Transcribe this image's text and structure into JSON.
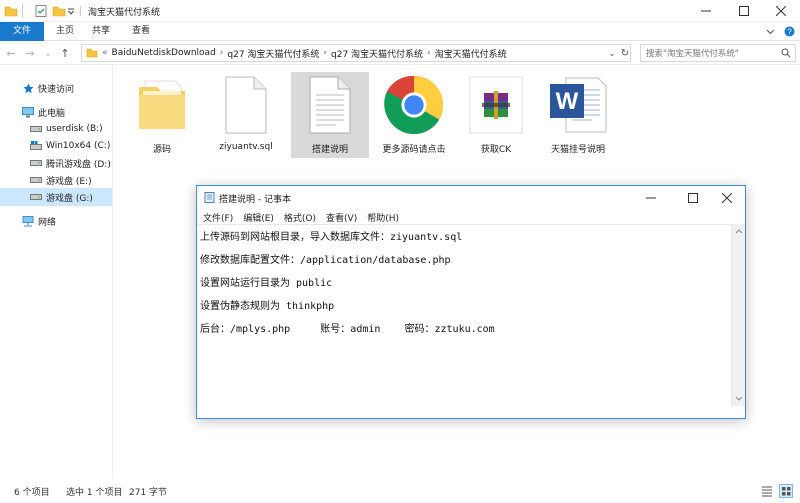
{
  "explorer": {
    "title": "淘宝天猫代付系统",
    "ribbon_tabs": [
      "文件",
      "主页",
      "共享",
      "查看"
    ],
    "breadcrumb": [
      "BaiduNetdiskDownload",
      "q27 淘宝天猫代付系统",
      "q27 淘宝天猫代付系统",
      "淘宝天猫代付系统"
    ],
    "breadcrumb_prefix": "«",
    "search_placeholder": "搜索\"淘宝天猫代付系统\""
  },
  "sidebar": {
    "items": [
      {
        "label": "快速访问",
        "icon": "star-icon"
      },
      {
        "label": "此电脑",
        "icon": "computer-icon"
      },
      {
        "label": "userdisk (B:)",
        "icon": "drive-icon"
      },
      {
        "label": "Win10x64 (C:)",
        "icon": "windows-drive-icon"
      },
      {
        "label": "腾讯游戏盘 (D:)",
        "icon": "drive-icon"
      },
      {
        "label": "游戏盘 (E:)",
        "icon": "drive-icon"
      },
      {
        "label": "游戏盘 (G:)",
        "icon": "drive-icon",
        "selected": true
      },
      {
        "label": "网络",
        "icon": "network-icon"
      }
    ]
  },
  "files": [
    {
      "label": "源码",
      "icon": "folder-icon"
    },
    {
      "label": "ziyuantv.sql",
      "icon": "sql-file-icon"
    },
    {
      "label": "搭建说明",
      "icon": "text-file-icon",
      "selected": true
    },
    {
      "label": "更多源码请点击",
      "icon": "chrome-icon"
    },
    {
      "label": "获取CK",
      "icon": "winrar-icon"
    },
    {
      "label": "天猫挂号说明",
      "icon": "word-icon"
    }
  ],
  "status": {
    "item_count": "6 个项目",
    "selected": "选中 1 个项目",
    "size": "271 字节"
  },
  "notepad": {
    "title": "搭建说明 - 记事本",
    "menu": [
      "文件(F)",
      "编辑(E)",
      "格式(O)",
      "查看(V)",
      "帮助(H)"
    ],
    "lines": [
      "上传源码到网站根目录，导入数据库文件：ziyuantv.sql",
      "修改数据库配置文件：/application/database.php",
      "设置网站运行目录为 public",
      "设置伪静态规则为 thinkphp",
      "后台：/mplys.php     账号：admin    密码：zztuku.com"
    ]
  },
  "colors": {
    "accent": "#1979ca",
    "selection": "#cce8ff",
    "file_selected": "#d9d9d9"
  }
}
